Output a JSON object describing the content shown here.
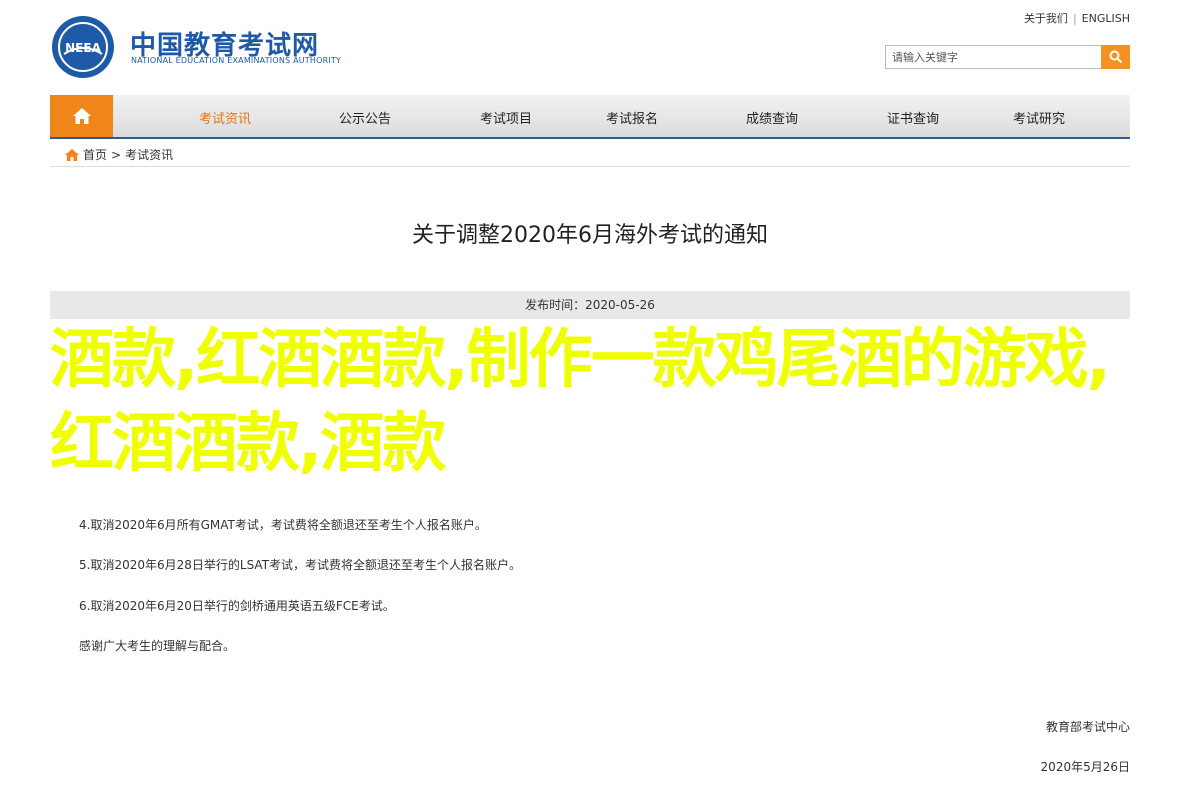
{
  "header": {
    "logo_badge": "NEEA",
    "site_name": "中国教育考试网",
    "site_name_en": "NATIONAL EDUCATION EXAMINATIONS AUTHORITY",
    "top_links": {
      "favorite": "关于我们",
      "english": "ENGLISH"
    },
    "search": {
      "placeholder": "请输入关键字",
      "button_icon": "search-icon"
    }
  },
  "nav": {
    "home_icon": "home-icon",
    "items": [
      "考试资讯",
      "公示公告",
      "考试项目",
      "考试报名",
      "成绩查询",
      "证书查询",
      "考试研究"
    ],
    "active_index": 0
  },
  "breadcrumb": {
    "home": "首页",
    "separator": ">",
    "current": "考试资讯"
  },
  "article": {
    "title": "关于调整2020年6月海外考试的通知",
    "date_label": "发布时间：2020-05-26",
    "paragraphs": [
      "4.取消2020年6月所有GMAT考试，考试费将全额退还至考生个人报名账户。",
      "5.取消2020年6月28日举行的LSAT考试，考试费将全额退还至考生个人报名账户。",
      "6.取消2020年6月20日举行的剑桥通用英语五级FCE考试。",
      "感谢广大考生的理解与配合。"
    ],
    "signature": "教育部考试中心",
    "signature_date": "2020年5月26日"
  },
  "overlay_text": "酒款,红酒酒款,制作一款鸡尾酒的游戏,红酒酒款,酒款",
  "colors": {
    "brand_blue": "#1e5aa8",
    "accent_orange": "#f08519",
    "overlay_yellow": "#f0ff00"
  }
}
